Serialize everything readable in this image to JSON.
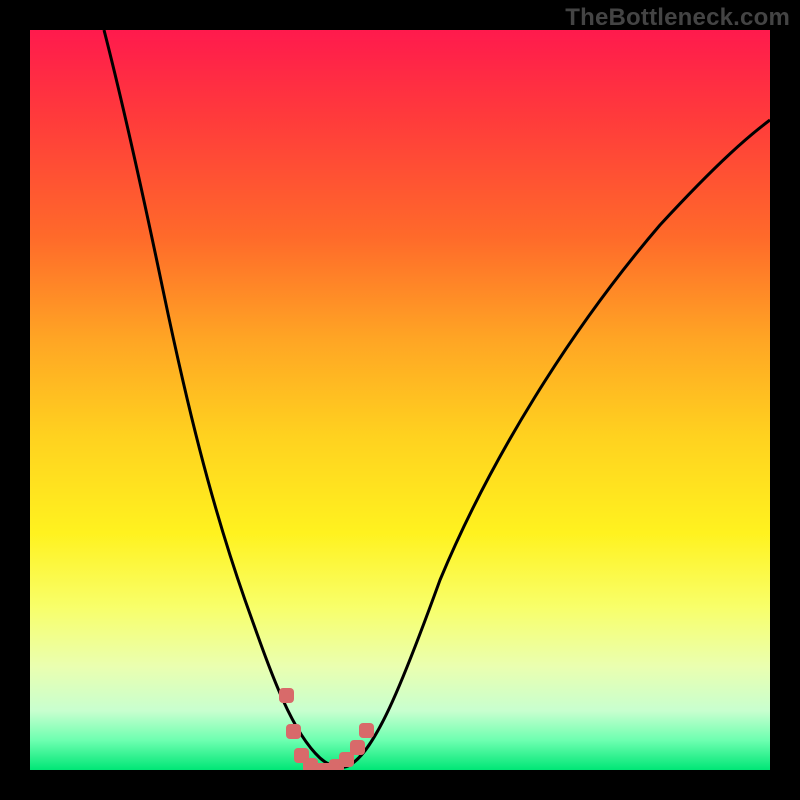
{
  "watermark": "TheBottleneck.com",
  "colors": {
    "background": "#000000",
    "curve_stroke": "#000000",
    "marker_fill": "#d86a6a",
    "gradient_top": "#ff1a4d",
    "gradient_bottom": "#00e676"
  },
  "chart_data": {
    "type": "line",
    "title": "",
    "xlabel": "",
    "ylabel": "",
    "xlim": [
      0,
      100
    ],
    "ylim": [
      0,
      100
    ],
    "grid": false,
    "legend": false,
    "annotations": [
      "TheBottleneck.com"
    ],
    "series": [
      {
        "name": "curve",
        "x": [
          10,
          14,
          18,
          22,
          26,
          30,
          33,
          36,
          38,
          40,
          42,
          46,
          50,
          55,
          62,
          70,
          80,
          90,
          100
        ],
        "y": [
          100,
          85,
          70,
          56,
          43,
          31,
          22,
          14,
          8,
          3,
          1,
          3,
          8,
          16,
          28,
          42,
          58,
          72,
          83
        ]
      }
    ],
    "markers": {
      "name": "highlight-dots",
      "x": [
        34.2,
        35.2,
        36.3,
        37.5,
        38.6,
        39.7,
        41.0,
        42.3,
        43.7,
        45.0
      ],
      "y": [
        10.0,
        5.3,
        2.0,
        0.7,
        0.0,
        0.0,
        0.5,
        1.5,
        3.2,
        5.5
      ]
    },
    "background_type": "gradient_vertical_red_to_green"
  }
}
